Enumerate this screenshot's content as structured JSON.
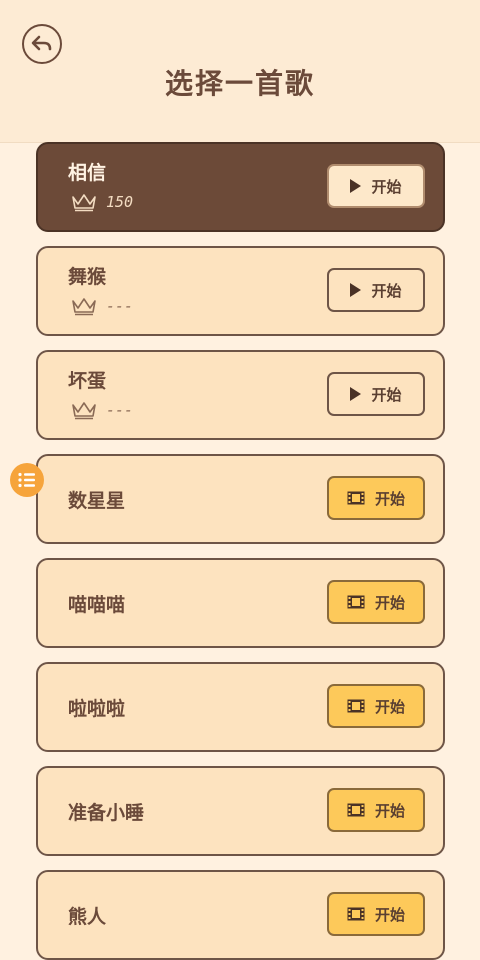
{
  "header": {
    "title": "选择一首歌"
  },
  "songs": [
    {
      "title": "相信",
      "score": "150",
      "button": "开始",
      "locked": false,
      "active": true
    },
    {
      "title": "舞猴",
      "score": "---",
      "button": "开始",
      "locked": false,
      "active": false
    },
    {
      "title": "坏蛋",
      "score": "---",
      "button": "开始",
      "locked": false,
      "active": false
    },
    {
      "title": "数星星",
      "button": "开始",
      "locked": true,
      "active": false
    },
    {
      "title": "喵喵喵",
      "button": "开始",
      "locked": true,
      "active": false
    },
    {
      "title": "啦啦啦",
      "button": "开始",
      "locked": true,
      "active": false
    },
    {
      "title": "准备小睡",
      "button": "开始",
      "locked": true,
      "active": false
    },
    {
      "title": "熊人",
      "button": "开始",
      "locked": true,
      "active": false
    }
  ],
  "colors": {
    "background": "#fff1e0",
    "card": "#fde3bf",
    "active_card": "#6c4a38",
    "locked_button": "#fdc95a",
    "floating_menu": "#f6a43b"
  },
  "icons": {
    "back": "back-arrow-icon",
    "crown": "crown-icon",
    "play": "play-icon",
    "film": "film-icon",
    "menu": "list-icon"
  }
}
